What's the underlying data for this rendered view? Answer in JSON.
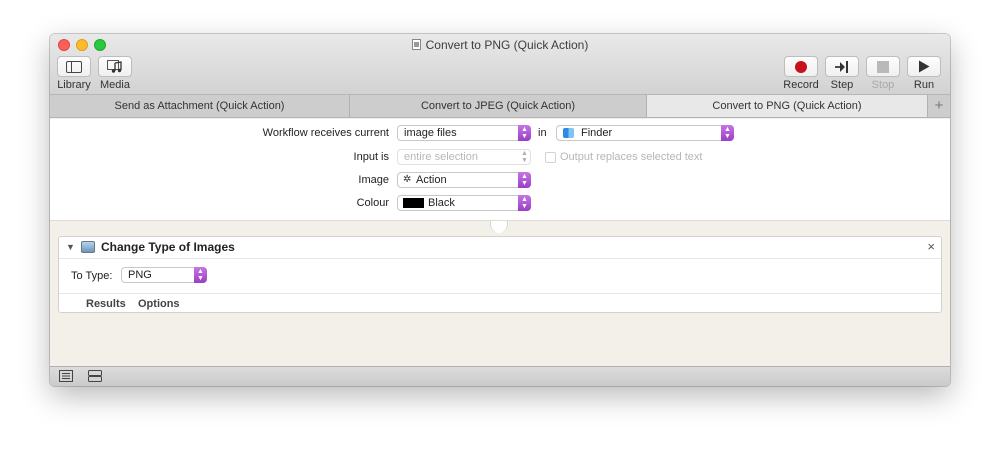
{
  "window": {
    "title": "Convert to PNG (Quick Action)"
  },
  "toolbar": {
    "library_label": "Library",
    "media_label": "Media",
    "record_label": "Record",
    "step_label": "Step",
    "stop_label": "Stop",
    "run_label": "Run"
  },
  "tabs": [
    {
      "label": "Send as Attachment (Quick Action)",
      "active": false
    },
    {
      "label": "Convert to JPEG (Quick Action)",
      "active": false
    },
    {
      "label": "Convert to PNG (Quick Action)",
      "active": true
    }
  ],
  "tab_add_glyph": "+",
  "workflow": {
    "receives_label": "Workflow receives current",
    "receives_value": "image files",
    "in_label": "in",
    "app_value": "Finder",
    "input_is_label": "Input is",
    "input_is_value": "entire selection",
    "output_replaces_label": "Output replaces selected text",
    "image_label": "Image",
    "image_value": "Action",
    "colour_label": "Colour",
    "colour_value": "Black",
    "colour_swatch": "#000000"
  },
  "action": {
    "title": "Change Type of Images",
    "to_type_label": "To Type:",
    "to_type_value": "PNG",
    "results_label": "Results",
    "options_label": "Options",
    "close_glyph": "×",
    "disclosure_glyph": "▼"
  },
  "colors": {
    "accent_purple": "#a94fd1",
    "record_red": "#c8101d"
  }
}
